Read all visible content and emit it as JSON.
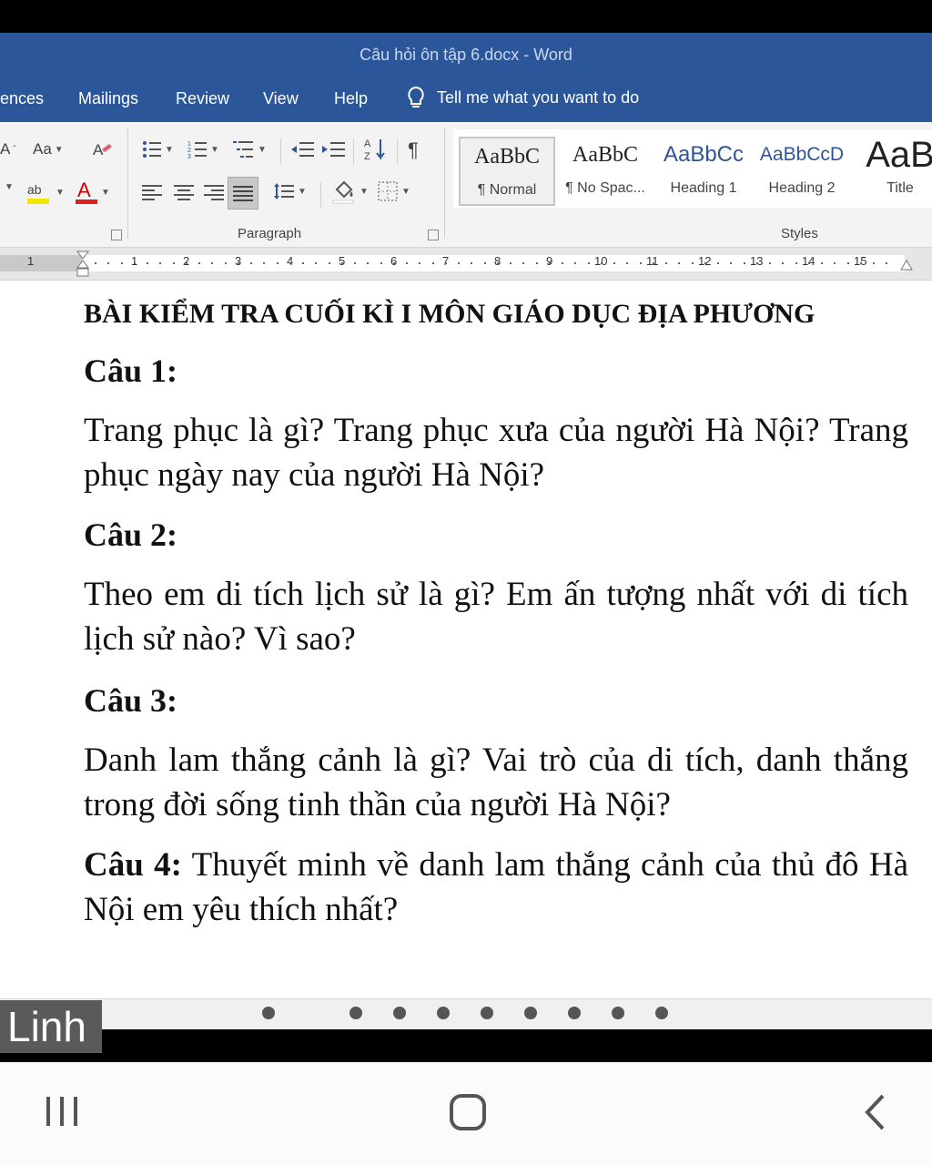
{
  "window": {
    "title": "Câu hỏi ôn tập 6.docx  -  Word"
  },
  "tabs": [
    "ences",
    "Mailings",
    "Review",
    "View",
    "Help"
  ],
  "tell_me": "Tell me what you want to do",
  "ribbon": {
    "font_case_label": "Aa",
    "paragraph_label": "Paragraph",
    "styles_label": "Styles",
    "styles": [
      {
        "sample": "AaBbC",
        "name": "¶ Normal"
      },
      {
        "sample": "AaBbC",
        "name": "¶ No Spac..."
      },
      {
        "sample": "AaBbCc",
        "name": "Heading 1"
      },
      {
        "sample": "AaBbCcD",
        "name": "Heading 2"
      },
      {
        "sample": "AaB",
        "name": "Title"
      }
    ],
    "accent_colors": {
      "highlight": "#f3e600",
      "font_color": "#e02020",
      "heading": "#2f5597"
    }
  },
  "ruler": {
    "left_number": "1",
    "numbers": [
      "1",
      "2",
      "3",
      "4",
      "5",
      "6",
      "7",
      "8",
      "9",
      "10",
      "11",
      "12",
      "13",
      "14",
      "15"
    ]
  },
  "document": {
    "title": "BÀI KIỂM TRA CUỐI KÌ I MÔN GIÁO DỤC ĐỊA PHƯƠNG",
    "q1_head": "Câu 1:",
    "q1_text": "Trang phục là gì? Trang phục xưa của người Hà Nội? Trang phục ngày nay của người Hà Nội?",
    "q2_head": "Câu 2:",
    "q2_text": "Theo em di tích lịch sử là gì? Em ấn tượng nhất với di tích lịch sử nào? Vì sao?",
    "q3_head": "Câu 3:",
    "q3_text": "Danh lam thắng cảnh là gì? Vai trò của di tích, danh thắng trong đời sống tinh thần của người Hà Nội?",
    "q4_head": "Câu 4:",
    "q4_text": "Thuyết minh về danh lam thắng cảnh của thủ đô Hà Nội em yêu thích nhất?"
  },
  "participant": {
    "name": "Linh"
  },
  "nav": {
    "recents_icon": "recents-icon",
    "home_icon": "home-icon",
    "back_icon": "back-icon"
  }
}
